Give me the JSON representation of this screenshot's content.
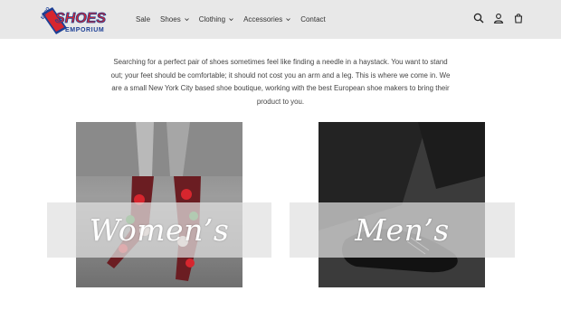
{
  "logo": {
    "top_word": "EURO",
    "main_word": "SHOES",
    "sub_word": "EMPORIUM"
  },
  "nav": {
    "items": [
      {
        "label": "Sale",
        "has_dropdown": false
      },
      {
        "label": "Shoes",
        "has_dropdown": true
      },
      {
        "label": "Clothing",
        "has_dropdown": true
      },
      {
        "label": "Accessories",
        "has_dropdown": true
      },
      {
        "label": "Contact",
        "has_dropdown": false
      }
    ]
  },
  "header_icons": [
    "search-icon",
    "account-icon",
    "cart-icon"
  ],
  "intro": {
    "text": "Searching for a perfect pair of shoes sometimes feel like finding a needle in a haystack. You want to stand out; your feet should be comfortable; it should not cost you an arm and a leg. This is where we come in. We are a small New York City based shoe boutique, working with the best European shoe makers to bring their product to you."
  },
  "collections": [
    {
      "label": "Women’s"
    },
    {
      "label": "Men’s"
    }
  ],
  "colors": {
    "header_bg": "#e8e8e8",
    "logo_blue": "#1c3f95",
    "logo_red": "#d7262e",
    "band_bg": "#e1e1e1"
  }
}
